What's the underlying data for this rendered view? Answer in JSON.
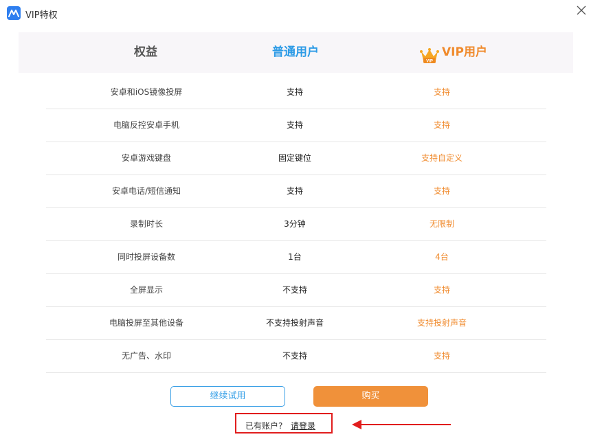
{
  "window": {
    "title": "VIP特权"
  },
  "header": {
    "col_feature": "权益",
    "col_normal": "普通用户",
    "col_vip": "VIP用户",
    "crown_badge": "VIP"
  },
  "rows": [
    {
      "feature": "安卓和iOS镜像投屏",
      "normal": "支持",
      "vip": "支持"
    },
    {
      "feature": "电脑反控安卓手机",
      "normal": "支持",
      "vip": "支持"
    },
    {
      "feature": "安卓游戏键盘",
      "normal": "固定键位",
      "vip": "支持自定义"
    },
    {
      "feature": "安卓电话/短信通知",
      "normal": "支持",
      "vip": "支持"
    },
    {
      "feature": "录制时长",
      "normal": "3分钟",
      "vip": "无限制"
    },
    {
      "feature": "同时投屏设备数",
      "normal": "1台",
      "vip": "4台"
    },
    {
      "feature": "全屏显示",
      "normal": "不支持",
      "vip": "支持"
    },
    {
      "feature": "电脑投屏至其他设备",
      "normal": "不支持投射声音",
      "vip": "支持投射声音"
    },
    {
      "feature": "无广告、水印",
      "normal": "不支持",
      "vip": "支持"
    }
  ],
  "buttons": {
    "trial": "继续试用",
    "buy": "购买"
  },
  "login": {
    "question": "已有账户?",
    "link": "请登录"
  },
  "colors": {
    "blue": "#2c9be6",
    "orange": "#f08a2c",
    "annotation_red": "#e11d1d"
  },
  "icons": {
    "app": "app-logo-icon",
    "close": "close-icon",
    "crown": "crown-icon",
    "arrow": "red-arrow-annotation"
  }
}
